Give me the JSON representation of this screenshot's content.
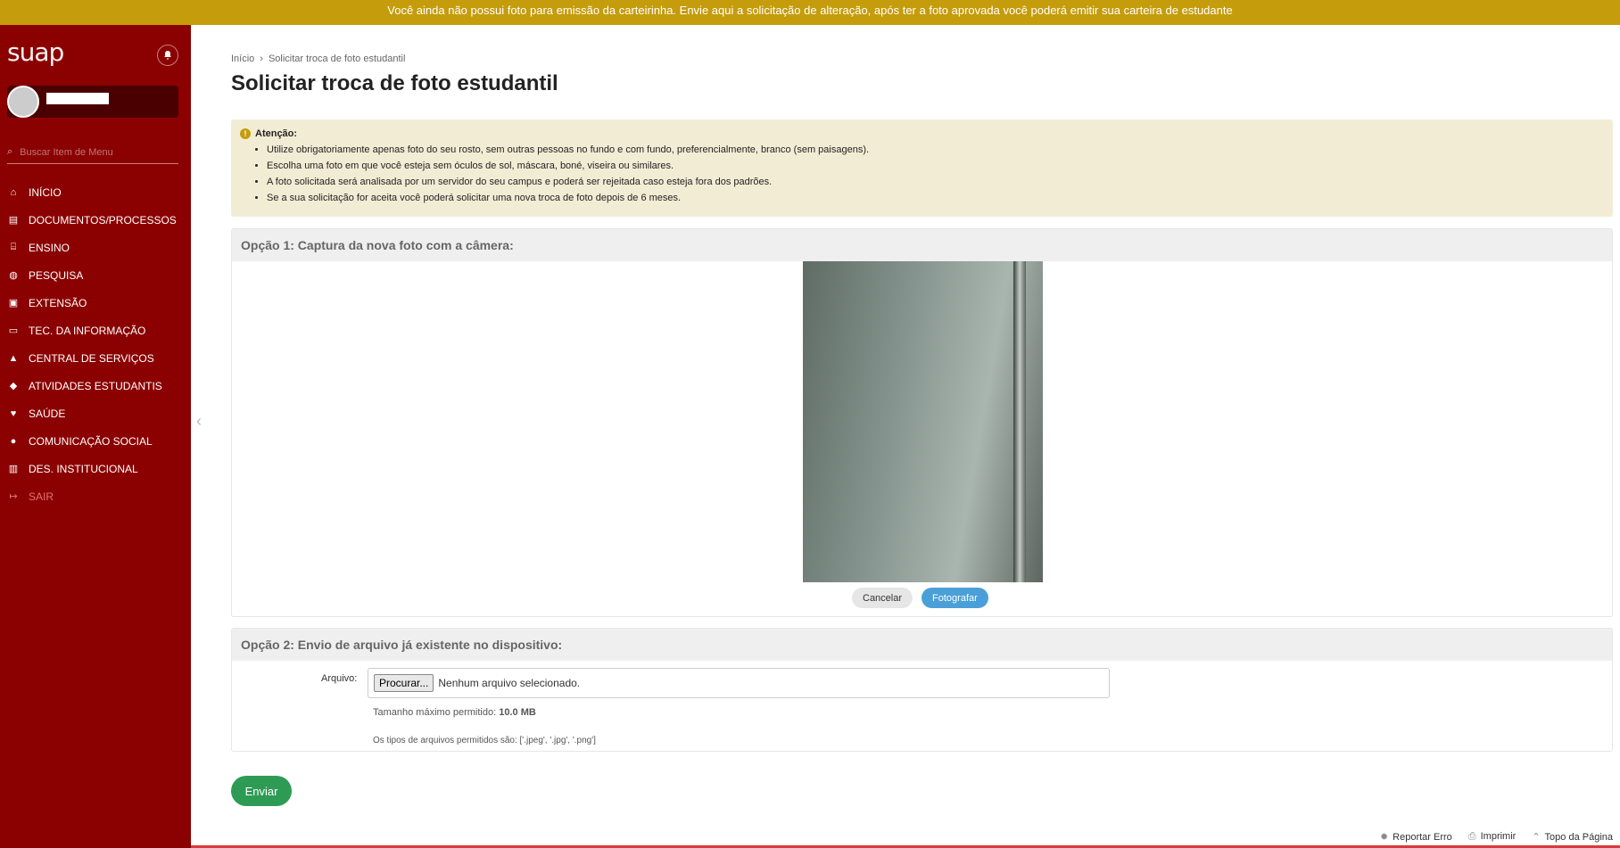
{
  "notice": "Você ainda não possui foto para emissão da carteirinha. Envie aqui a solicitação de alteração, após ter a foto aprovada você poderá emitir sua carteira de estudante",
  "sidebar": {
    "logo": "suap",
    "search_placeholder": "Buscar Item de Menu",
    "items": [
      {
        "label": "INÍCIO",
        "icon": "home-icon"
      },
      {
        "label": "DOCUMENTOS/PROCESSOS",
        "icon": "document-icon"
      },
      {
        "label": "ENSINO",
        "icon": "teaching-icon"
      },
      {
        "label": "PESQUISA",
        "icon": "globe-icon"
      },
      {
        "label": "EXTENSÃO",
        "icon": "briefcase-icon"
      },
      {
        "label": "TEC. DA INFORMAÇÃO",
        "icon": "laptop-icon"
      },
      {
        "label": "CENTRAL DE SERVIÇOS",
        "icon": "service-icon"
      },
      {
        "label": "ATIVIDADES ESTUDANTIS",
        "icon": "graduation-icon"
      },
      {
        "label": "SAÚDE",
        "icon": "heart-icon"
      },
      {
        "label": "COMUNICAÇÃO SOCIAL",
        "icon": "chat-icon"
      },
      {
        "label": "DES. INSTITUCIONAL",
        "icon": "chart-icon"
      },
      {
        "label": "SAIR",
        "icon": "logout-icon"
      }
    ]
  },
  "breadcrumb": {
    "home": "Início",
    "current": "Solicitar troca de foto estudantil"
  },
  "page_title": "Solicitar troca de foto estudantil",
  "alert": {
    "title": "Atenção:",
    "items": [
      "Utilize obrigatoriamente apenas foto do seu rosto, sem outras pessoas no fundo e com fundo, preferencialmente, branco (sem paisagens).",
      "Escolha uma foto em que você esteja sem óculos de sol, máscara, boné, viseira ou similares.",
      "A foto solicitada será analisada por um servidor do seu campus e poderá ser rejeitada caso esteja fora dos padrões.",
      "Se a sua solicitação for aceita você poderá solicitar uma nova troca de foto depois de 6 meses."
    ]
  },
  "option1": {
    "legend": "Opção 1: Captura da nova foto com a câmera:",
    "cancel": "Cancelar",
    "photo": "Fotografar"
  },
  "option2": {
    "legend": "Opção 2: Envio de arquivo já existente no dispositivo:",
    "label": "Arquivo:",
    "browse": "Procurar...",
    "no_file": "Nenhum arquivo selecionado.",
    "max_size_label": "Tamanho máximo permitido:",
    "max_size": "10.0 MB",
    "types": "Os tipos de arquivos permitidos são: ['.jpeg', '.jpg', '.png']"
  },
  "submit": "Enviar",
  "footer": {
    "report": "Reportar Erro",
    "print": "Imprimir",
    "top": "Topo da Página"
  }
}
